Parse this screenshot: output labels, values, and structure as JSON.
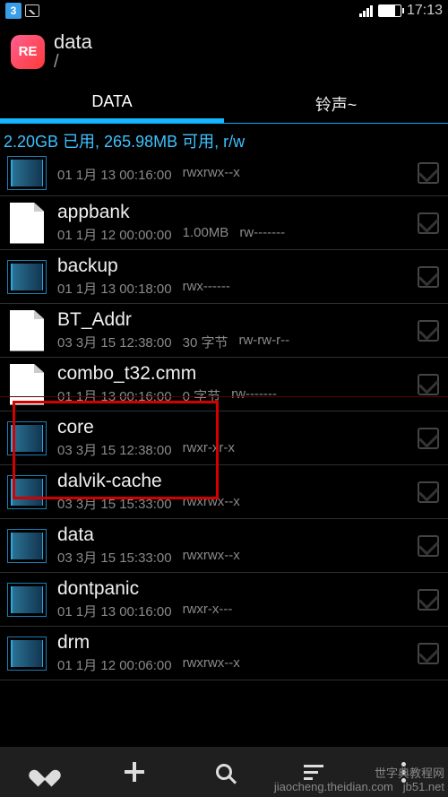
{
  "statusbar": {
    "notif_count": "3",
    "clock": "17:13"
  },
  "header": {
    "app_icon_text": "RE",
    "title": "data",
    "path": "/"
  },
  "tabs": [
    {
      "label": "DATA",
      "active": true
    },
    {
      "label": "铃声~",
      "active": false
    }
  ],
  "storage_line": "2.20GB 已用, 265.98MB 可用, r/w",
  "items": [
    {
      "type": "folder",
      "name": "",
      "date": "01 1月 13 00:16:00",
      "size": "",
      "perm": "rwxrwx--x"
    },
    {
      "type": "file",
      "name": "appbank",
      "date": "01 1月 12 00:00:00",
      "size": "1.00MB",
      "perm": "rw-------"
    },
    {
      "type": "folder",
      "name": "backup",
      "date": "01 1月 13 00:18:00",
      "size": "",
      "perm": "rwx------"
    },
    {
      "type": "file",
      "name": "BT_Addr",
      "date": "03 3月 15 12:38:00",
      "size": "30 字节",
      "perm": "rw-rw-r--"
    },
    {
      "type": "file",
      "name": "combo_t32.cmm",
      "date": "01 1月 13 00:16:00",
      "size": "0 字节",
      "perm": "rw-------"
    },
    {
      "type": "folder",
      "name": "core",
      "date": "03 3月 15 12:38:00",
      "size": "",
      "perm": "rwxr-xr-x"
    },
    {
      "type": "folder",
      "name": "dalvik-cache",
      "date": "03 3月 15 15:33:00",
      "size": "",
      "perm": "rwxrwx--x"
    },
    {
      "type": "folder",
      "name": "data",
      "date": "03 3月 15 15:33:00",
      "size": "",
      "perm": "rwxrwx--x"
    },
    {
      "type": "folder",
      "name": "dontpanic",
      "date": "01 1月 13 00:16:00",
      "size": "",
      "perm": "rwxr-x---"
    },
    {
      "type": "folder",
      "name": "drm",
      "date": "01 1月 12 00:06:00",
      "size": "",
      "perm": "rwxrwx--x"
    }
  ],
  "highlighted_item_index": 5,
  "watermark": {
    "line1": "世字典教程网",
    "line2": "jiaocheng.theidian.com",
    "line3": "jb51.net"
  }
}
